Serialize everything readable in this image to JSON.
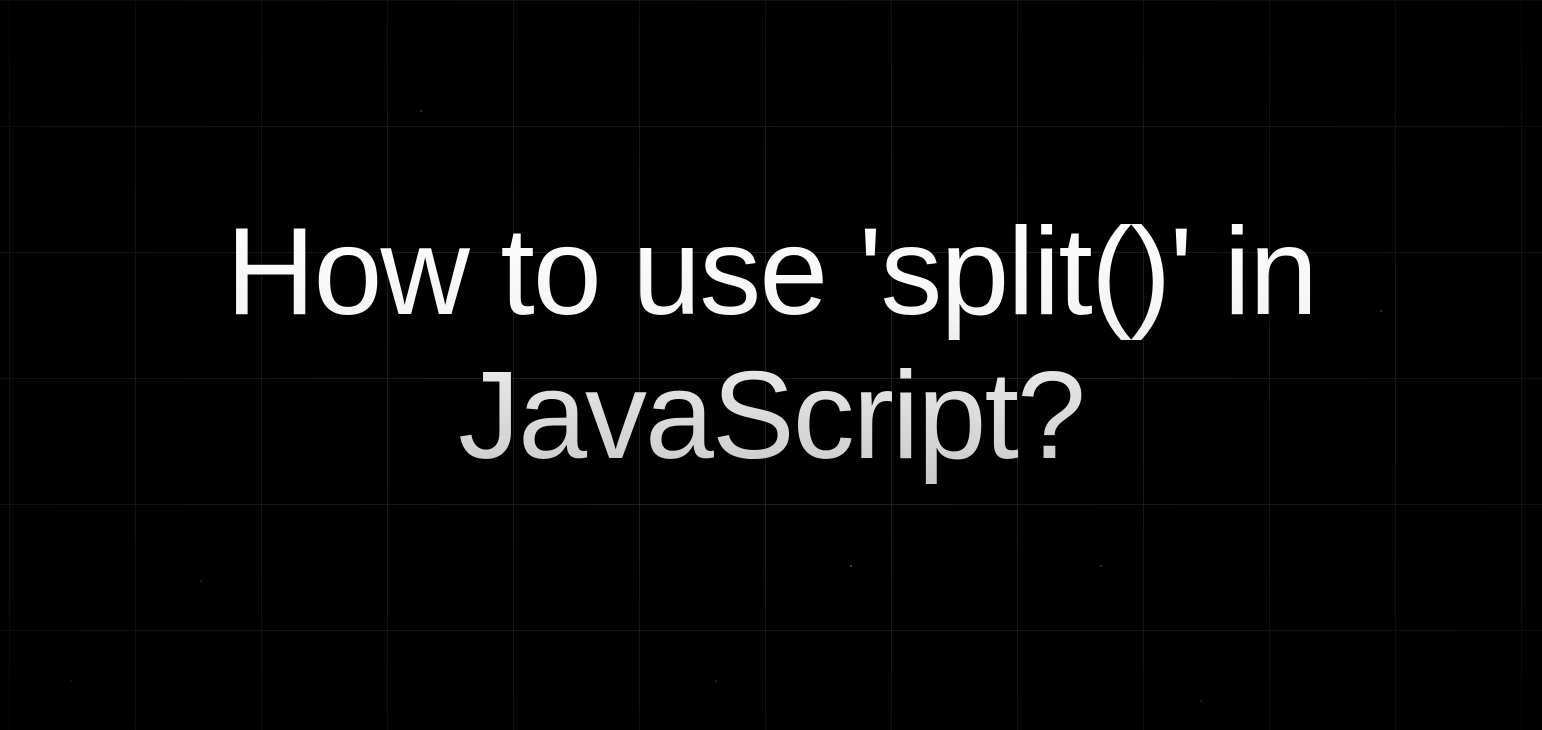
{
  "hero": {
    "title": "How to use 'split()' in JavaScript?"
  }
}
